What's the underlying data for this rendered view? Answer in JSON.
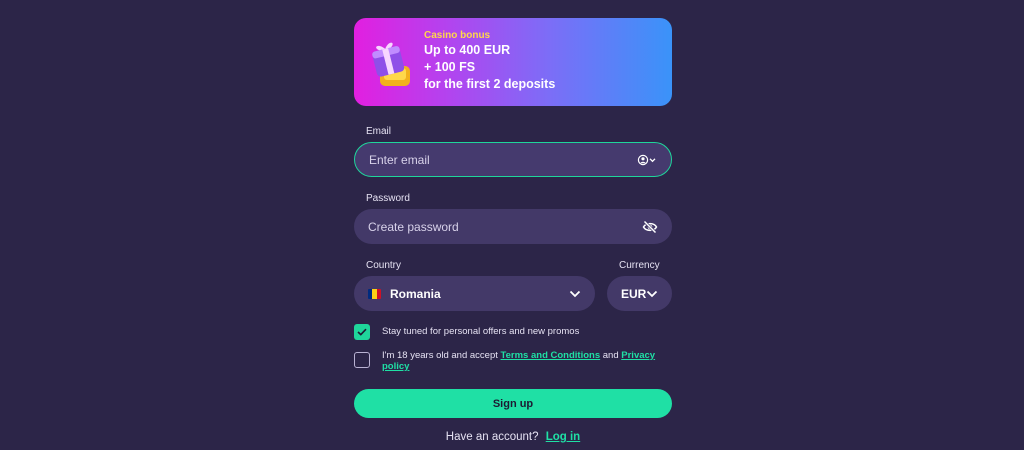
{
  "banner": {
    "kicker": "Casino bonus",
    "line1": "Up to 400 EUR",
    "line2": "+ 100 FS",
    "line3": "for the first 2 deposits",
    "icon": "gift-box-icon"
  },
  "email": {
    "label": "Email",
    "placeholder": "Enter email",
    "icon": "account-dropdown-icon"
  },
  "password": {
    "label": "Password",
    "placeholder": "Create password",
    "icon": "eye-off-icon"
  },
  "country": {
    "label": "Country",
    "value": "Romania",
    "flag_colors": [
      "#002b7f",
      "#fcd116",
      "#ce1126"
    ]
  },
  "currency": {
    "label": "Currency",
    "value": "EUR"
  },
  "offers": {
    "text": "Stay tuned for personal offers and new promos",
    "checked": true
  },
  "terms": {
    "prefix": "I'm 18 years old and accept",
    "terms_link": "Terms and Conditions",
    "and": "and",
    "privacy_link": "Privacy policy",
    "checked": false
  },
  "signup_label": "Sign up",
  "login": {
    "prompt": "Have an account?",
    "link": "Log in"
  },
  "colors": {
    "background": "#2c2548",
    "field": "#433968",
    "accent": "#1fe0a5"
  }
}
